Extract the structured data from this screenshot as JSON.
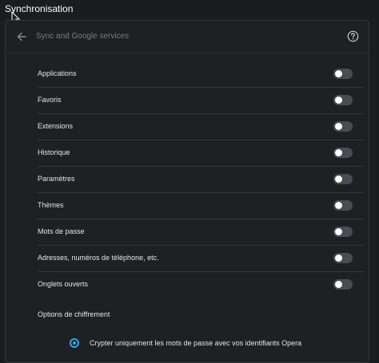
{
  "page_title": "Synchronisation",
  "header": {
    "title": "Sync and Google services",
    "back_icon": "arrow-left-icon",
    "help_icon": "help-circle-icon"
  },
  "sync_items": [
    {
      "label": "Applications",
      "enabled": false
    },
    {
      "label": "Favoris",
      "enabled": false
    },
    {
      "label": "Extensions",
      "enabled": false
    },
    {
      "label": "Historique",
      "enabled": false
    },
    {
      "label": "Paramètres",
      "enabled": false
    },
    {
      "label": "Thèmes",
      "enabled": false
    },
    {
      "label": "Mots de passe",
      "enabled": false
    },
    {
      "label": "Adresses, numéros de téléphone, etc.",
      "enabled": false
    },
    {
      "label": "Onglets ouverts",
      "enabled": false
    }
  ],
  "encryption": {
    "section_label": "Options de chiffrement",
    "option_label": "Crypter uniquement les mots de passe avec vos identifiants Opera",
    "selected": true
  },
  "colors": {
    "background": "#1b1c20",
    "panel": "#1f2024",
    "toggle_off": "#4a4c53",
    "accent": "#2ea7e6",
    "text": "#e4e5e8",
    "muted_text": "#7a7d85"
  }
}
